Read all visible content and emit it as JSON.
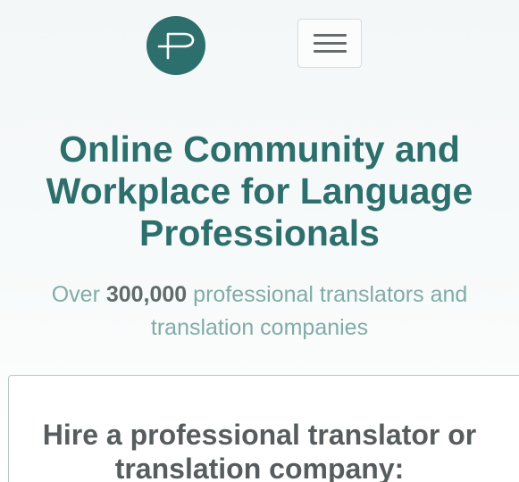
{
  "header": {
    "logo_icon": "proz-logo-icon",
    "menu_icon": "hamburger-menu-icon",
    "brand_color": "#2d6f6c"
  },
  "hero": {
    "title_line1": "Online Community and",
    "title_line2": "Workplace for Language",
    "title_line3": "Professionals",
    "subtitle_prefix": "Over ",
    "subtitle_count": "300,000",
    "subtitle_suffix": " professional translators and",
    "subtitle_line2": "translation companies"
  },
  "card": {
    "title_line1": "Hire a professional translator or",
    "title_line2": "translation company:"
  }
}
